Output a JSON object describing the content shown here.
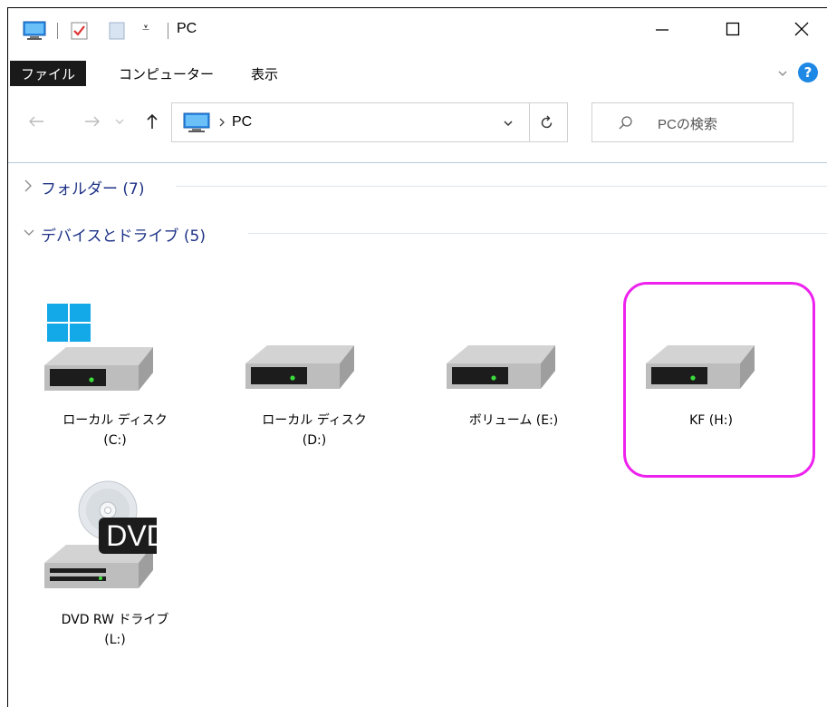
{
  "window": {
    "title": "PC"
  },
  "quick_access": {
    "dropdown_glyph": "⩡"
  },
  "ribbon": {
    "tabs": [
      "ファイル",
      "コンピューター",
      "表示"
    ],
    "help": "?"
  },
  "nav": {
    "location": "PC",
    "search_placeholder": "PCの検索"
  },
  "groups": [
    {
      "label": "フォルダー (7)",
      "expanded": false
    },
    {
      "label": "デバイスとドライブ (5)",
      "expanded": true
    }
  ],
  "drives": [
    {
      "line1": "ローカル ディスク",
      "line2": "(C:)",
      "icon": "system-drive-icon"
    },
    {
      "line1": "ローカル ディスク",
      "line2": "(D:)",
      "icon": "hard-drive-icon"
    },
    {
      "line1": "ボリューム (E:)",
      "line2": "",
      "icon": "hard-drive-icon"
    },
    {
      "line1": "KF (H:)",
      "line2": "",
      "icon": "hard-drive-icon",
      "highlighted": true
    },
    {
      "line1": "DVD RW ドライブ",
      "line2": "(L:)",
      "icon": "dvd-drive-icon",
      "badge": "DVD"
    }
  ],
  "colors": {
    "group_label": "#1e3287",
    "highlight": "#ee22ee",
    "accent": "#1e88e5"
  }
}
